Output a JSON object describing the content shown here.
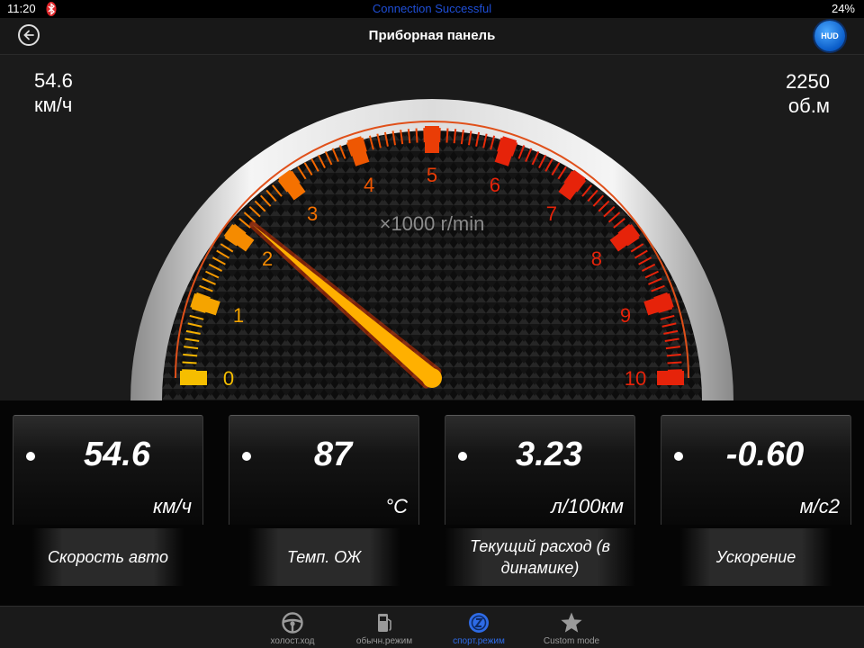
{
  "status_bar": {
    "time": "11:20",
    "connection": "Connection Successful",
    "battery": "24%",
    "bluetooth_icon": "bluetooth-icon"
  },
  "nav": {
    "title": "Приборная панель",
    "back_icon": "back-arrow-icon",
    "hud_label": "HUD"
  },
  "readouts": {
    "speed_value": "54.6",
    "speed_unit": "км/ч",
    "rpm_value": "2250",
    "rpm_unit": "об.м"
  },
  "gauge": {
    "unit_label": "×1000 r/min",
    "tick_labels": [
      "0",
      "1",
      "2",
      "3",
      "4",
      "5",
      "6",
      "7",
      "8",
      "9",
      "10"
    ],
    "min": 0,
    "max": 10,
    "needle_value": 2.25
  },
  "cards": [
    {
      "value": "54.6",
      "unit": "км/ч",
      "label": "Скорость авто"
    },
    {
      "value": "87",
      "unit": "°C",
      "label": "Темп. ОЖ"
    },
    {
      "value": "3.23",
      "unit": "л/100км",
      "label": "Текущий расход (в динамике)"
    },
    {
      "value": "-0.60",
      "unit": "м/с2",
      "label": "Ускорение"
    }
  ],
  "tabs": [
    {
      "label": "холост.ход",
      "icon": "steering-wheel-icon",
      "active": false
    },
    {
      "label": "обычн.режим",
      "icon": "fuel-pump-icon",
      "active": false
    },
    {
      "label": "спорт.режим",
      "icon": "sport-mode-icon",
      "active": true
    },
    {
      "label": "Custom mode",
      "icon": "star-icon",
      "active": false
    }
  ],
  "colors": {
    "accent_blue": "#2e6be6",
    "gauge_orange": "#f5a300",
    "gauge_red": "#e02a10",
    "needle": "#ffb000"
  }
}
